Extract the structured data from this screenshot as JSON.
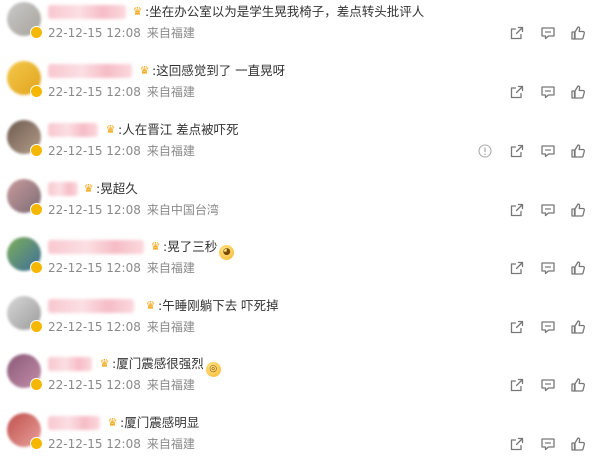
{
  "comments": [
    {
      "text": ":坐在办公室以为是学生晃我椅子，差点转头批评人",
      "time": "22-12-15 12:08",
      "location": "来自福建",
      "emoji": "",
      "avatar_colors": [
        "#c9c9c9",
        "#a8a39c"
      ]
    },
    {
      "text": ":这回感觉到了 一直晃呀",
      "time": "22-12-15 12:08",
      "location": "来自福建",
      "emoji": "",
      "avatar_colors": [
        "#f5c84a",
        "#e0a31d"
      ]
    },
    {
      "text": ":人在晋江 差点被吓死",
      "time": "22-12-15 12:08",
      "location": "来自福建",
      "emoji": "",
      "avatar_colors": [
        "#6e5c50",
        "#b39c8a"
      ]
    },
    {
      "text": ":晃超久",
      "time": "22-12-15 12:08",
      "location": "来自中国台湾",
      "emoji": "",
      "avatar_colors": [
        "#c89a9a",
        "#7d6d77"
      ]
    },
    {
      "text": ":晃了三秒",
      "time": "22-12-15 12:08",
      "location": "来自福建",
      "emoji": "blush-emoji",
      "avatar_colors": [
        "#7cae5a",
        "#3e6e9a"
      ]
    },
    {
      "text": ":午睡刚躺下去 吓死掉",
      "time": "22-12-15 12:08",
      "location": "来自福建",
      "emoji": "",
      "avatar_colors": [
        "#d7d7d7",
        "#9c9c9c"
      ]
    },
    {
      "text": ":厦门震感很强烈",
      "time": "22-12-15 12:08",
      "location": "来自福建",
      "emoji": "shocked-emoji",
      "avatar_colors": [
        "#8a5a78",
        "#c28ca8"
      ]
    },
    {
      "text": ":厦门震感明显",
      "time": "22-12-15 12:08",
      "location": "来自福建",
      "emoji": "",
      "avatar_colors": [
        "#c0504d",
        "#e8a09c"
      ]
    }
  ],
  "actions": {
    "share_icon": "share-icon",
    "comment_icon": "comment-icon",
    "like_icon": "like-icon",
    "report_icon": "report-icon"
  },
  "colors": {
    "text": "#333333",
    "meta": "#8a8a8a",
    "crown": "#f2a20c",
    "name_blur": "#f8c7cf"
  }
}
